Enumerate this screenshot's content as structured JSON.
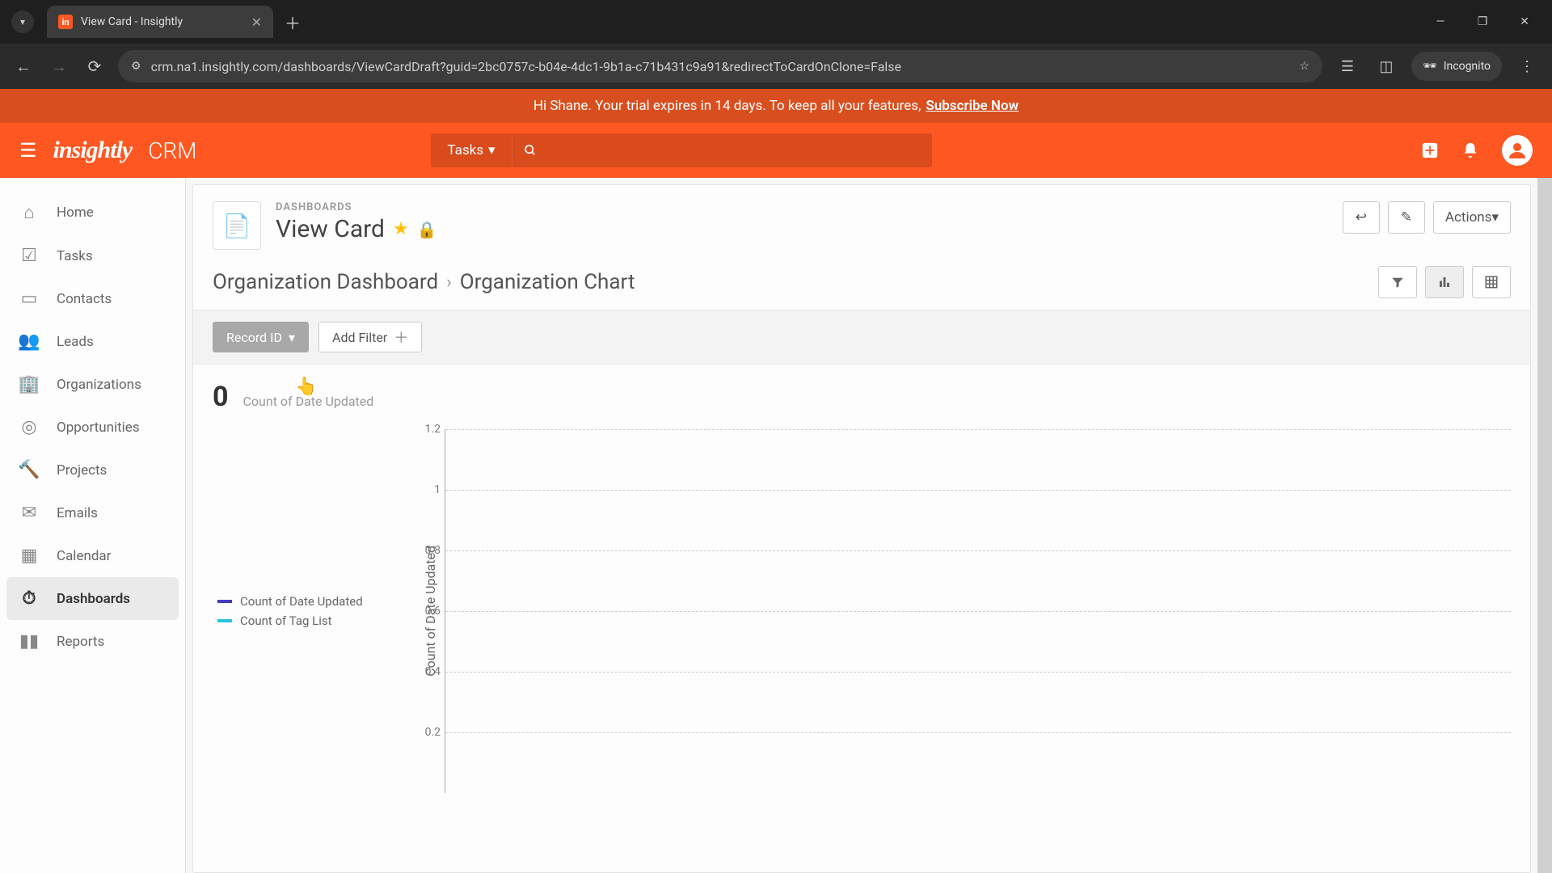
{
  "browser": {
    "tab_title": "View Card - Insightly",
    "favicon_text": "in",
    "url": "crm.na1.insightly.com/dashboards/ViewCardDraft?guid=2bc0757c-b04e-4dc1-9b1a-c71b431c9a91&redirectToCardOnClone=False",
    "incognito_label": "Incognito"
  },
  "trial": {
    "message": "Hi Shane. Your trial expires in 14 days. To keep all your features, ",
    "cta": "Subscribe Now"
  },
  "header": {
    "logo": "insightly",
    "app": "CRM",
    "search_category": "Tasks"
  },
  "sidebar": {
    "items": [
      {
        "label": "Home"
      },
      {
        "label": "Tasks"
      },
      {
        "label": "Contacts"
      },
      {
        "label": "Leads"
      },
      {
        "label": "Organizations"
      },
      {
        "label": "Opportunities"
      },
      {
        "label": "Projects"
      },
      {
        "label": "Emails"
      },
      {
        "label": "Calendar"
      },
      {
        "label": "Dashboards"
      },
      {
        "label": "Reports"
      }
    ]
  },
  "page": {
    "crumb_label": "DASHBOARDS",
    "title": "View Card",
    "actions_label": "Actions",
    "breadcrumb_a": "Organization Dashboard",
    "breadcrumb_b": "Organization Chart"
  },
  "filters": {
    "chip1": "Record ID",
    "add": "Add Filter"
  },
  "card": {
    "metric_value": "0",
    "metric_label": "Count of Date Updated",
    "legend1": "Count of Date Updated",
    "legend2": "Count of Tag List",
    "yaxis_label": "Count of Date Updated"
  },
  "chart_data": {
    "type": "line",
    "series": [
      {
        "name": "Count of Date Updated",
        "color": "#3f3fbf",
        "values": []
      },
      {
        "name": "Count of Tag List",
        "color": "#26c6da",
        "values": []
      }
    ],
    "ylabel": "Count of Date Updated",
    "ylim": [
      0,
      1.2
    ],
    "yticks": [
      0.2,
      0.4,
      0.6,
      0.8,
      1,
      1.2
    ]
  }
}
